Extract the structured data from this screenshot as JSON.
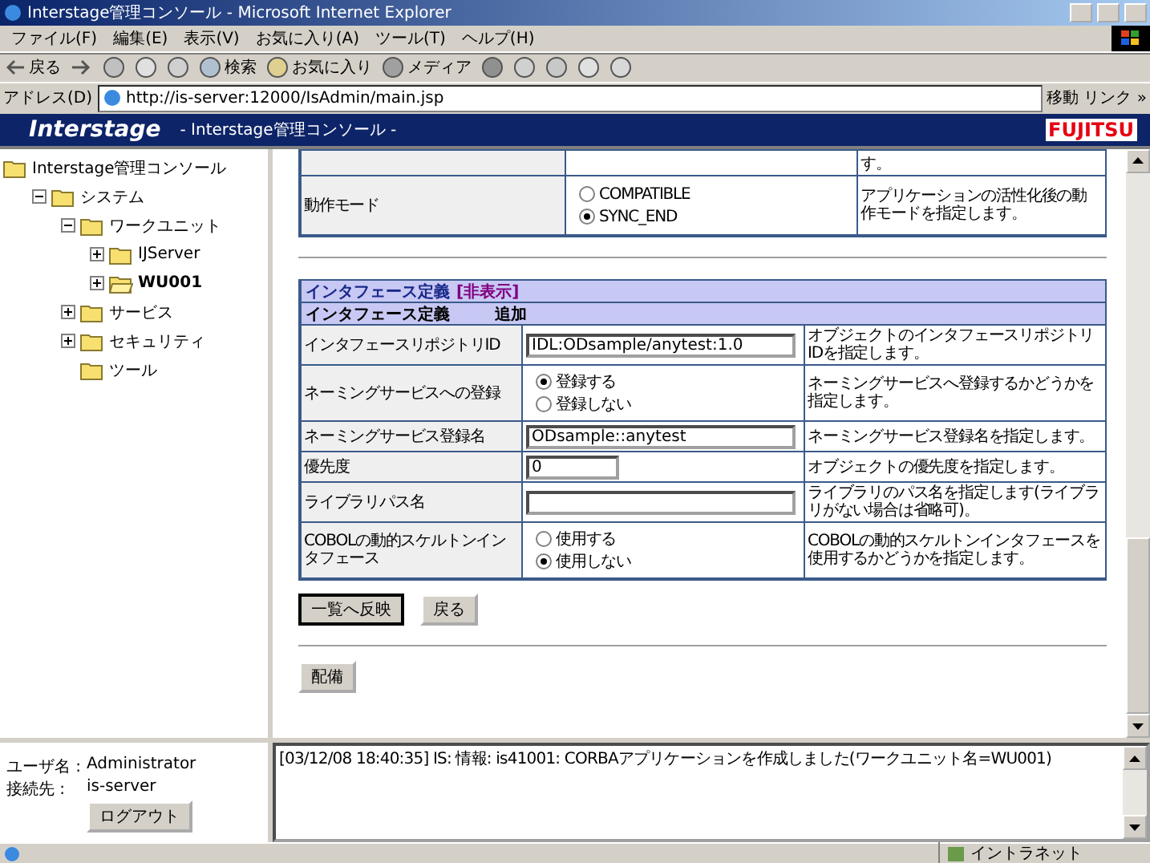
{
  "window": {
    "title": "Interstage管理コンソール - Microsoft Internet Explorer"
  },
  "menu": [
    "ファイル(F)",
    "編集(E)",
    "表示(V)",
    "お気に入り(A)",
    "ツール(T)",
    "ヘルプ(H)"
  ],
  "toolbar": {
    "back": "戻る",
    "search": "検索",
    "favorites": "お気に入り",
    "media": "メディア"
  },
  "address": {
    "label": "アドレス(D)",
    "url": "http://is-server:12000/IsAdmin/main.jsp",
    "go": "移動",
    "links": "リンク »"
  },
  "banner": {
    "logo": "Interstage",
    "title": "- Interstage管理コンソール -",
    "brand": "FUJITSU"
  },
  "tree": [
    {
      "label": "Interstage管理コンソール",
      "selected": false,
      "children": [
        {
          "label": "システム",
          "expanded": true,
          "selected": false,
          "children": [
            {
              "label": "ワークユニット",
              "expanded": true,
              "selected": false,
              "children": [
                {
                  "label": "IJServer",
                  "expanded": false,
                  "selected": false
                },
                {
                  "label": "WU001",
                  "expanded": false,
                  "selected": true
                }
              ]
            },
            {
              "label": "サービス",
              "expanded": false,
              "selected": false
            },
            {
              "label": "セキュリティ",
              "expanded": false,
              "selected": false
            },
            {
              "label": "ツール",
              "selected": false
            }
          ]
        }
      ]
    }
  ],
  "top_table": {
    "partial_desc": "す。",
    "mode": {
      "label": "動作モード",
      "options": [
        {
          "label": "COMPATIBLE",
          "selected": false
        },
        {
          "label": "SYNC_END",
          "selected": true
        }
      ],
      "desc": "アプリケーションの活性化後の動作モードを指定します。"
    }
  },
  "section": {
    "title": "インタフェース定義",
    "toggle": "[非表示]",
    "subtitle": "インタフェース定義",
    "add": "追加",
    "rows": [
      {
        "kind": "text",
        "label": "インタフェースリポジトリID",
        "value": "IDL:ODsample/anytest:1.0",
        "desc": "オブジェクトのインタフェースリポジトリIDを指定します。"
      },
      {
        "kind": "radio",
        "label": "ネーミングサービスへの登録",
        "options": [
          {
            "label": "登録する",
            "selected": true
          },
          {
            "label": "登録しない",
            "selected": false
          }
        ],
        "desc": "ネーミングサービスへ登録するかどうかを指定します。"
      },
      {
        "kind": "text",
        "label": "ネーミングサービス登録名",
        "value": "ODsample::anytest",
        "desc": "ネーミングサービス登録名を指定します。"
      },
      {
        "kind": "short",
        "label": "優先度",
        "value": "0",
        "desc": "オブジェクトの優先度を指定します。"
      },
      {
        "kind": "text",
        "label": "ライブラリパス名",
        "desc": "ライブラリのパス名を指定します(ライブラリがない場合は省略可)。"
      },
      {
        "kind": "radio",
        "label": "COBOLの動的スケルトンインタフェース",
        "options": [
          {
            "label": "使用する",
            "selected": false
          },
          {
            "label": "使用しない",
            "selected": true
          }
        ],
        "desc": "COBOLの動的スケルトンインタフェースを使用するかどうかを指定します。"
      }
    ]
  },
  "buttons": [
    "一覧へ反映",
    "戻る"
  ],
  "deploy_button": "配備",
  "user": {
    "name_label": "ユーザ名 :",
    "name": "Administrator",
    "host_label": "接続先 :",
    "host": "is-server",
    "logout": "ログアウト"
  },
  "log": "[03/12/08 18:40:35] IS: 情報: is41001: CORBAアプリケーションを作成しました(ワークユニット名=WU001)",
  "status": {
    "zone": "イントラネット"
  }
}
